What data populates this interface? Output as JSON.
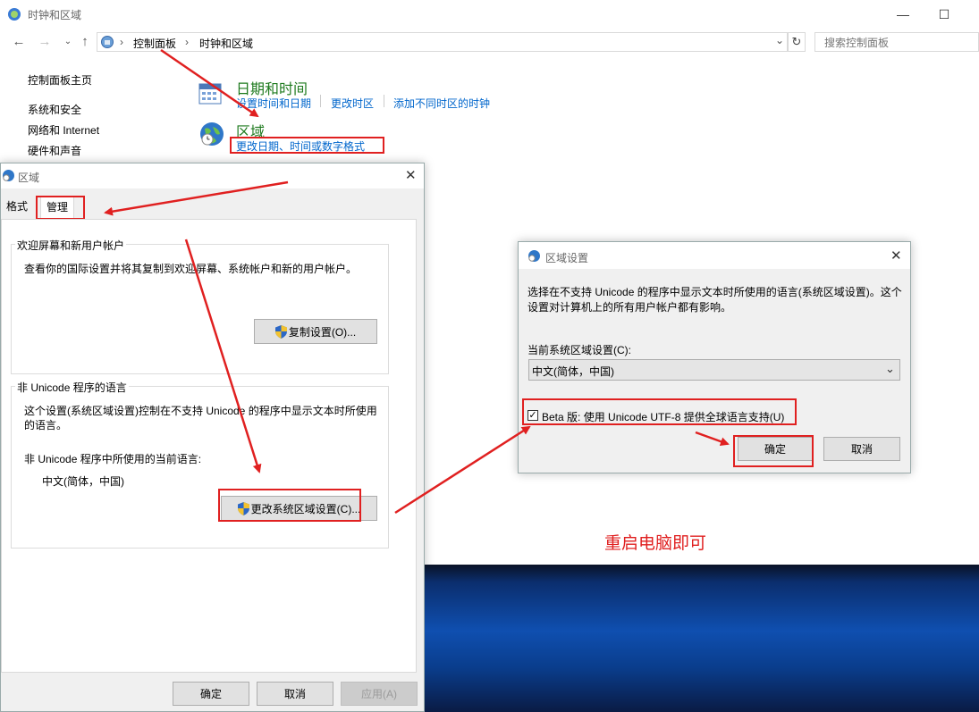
{
  "control_panel": {
    "title": "时钟和区域",
    "breadcrumb": [
      "控制面板",
      "时钟和区域"
    ],
    "search_placeholder": "搜索控制面板",
    "sidebar": [
      "控制面板主页",
      "系统和安全",
      "网络和 Internet",
      "硬件和声音"
    ],
    "datetime": {
      "heading": "日期和时间",
      "links": [
        "设置时间和日期",
        "更改时区",
        "添加不同时区的时钟"
      ]
    },
    "region": {
      "heading": "区域",
      "link": "更改日期、时间或数字格式"
    }
  },
  "region_dialog": {
    "title": "区域",
    "tabs": [
      "格式",
      "管理"
    ],
    "active_tab": "管理",
    "welcome_group": {
      "label": "欢迎屏幕和新用户帐户",
      "desc": "查看你的国际设置并将其复制到欢迎屏幕、系统帐户和新的用户帐户。",
      "copy_button": "复制设置(O)..."
    },
    "nonunicode_group": {
      "label": "非 Unicode 程序的语言",
      "desc": "这个设置(系统区域设置)控制在不支持 Unicode 的程序中显示文本时所使用的语言。",
      "current_label": "非 Unicode 程序中所使用的当前语言:",
      "current_value": "中文(简体，中国)",
      "change_button": "更改系统区域设置(C)..."
    },
    "buttons": {
      "ok": "确定",
      "cancel": "取消",
      "apply": "应用(A)"
    }
  },
  "region_settings_dialog": {
    "title": "区域设置",
    "desc": "选择在不支持 Unicode 的程序中显示文本时所使用的语言(系统区域设置)。这个设置对计算机上的所有用户帐户都有影响。",
    "current_label": "当前系统区域设置(C):",
    "current_value": "中文(简体，中国)",
    "beta_checkbox_label": "Beta 版: 使用 Unicode UTF-8 提供全球语言支持(U)",
    "beta_checked": true,
    "buttons": {
      "ok": "确定",
      "cancel": "取消"
    }
  },
  "annotation": {
    "note": "重启电脑即可",
    "color": "#e02020"
  }
}
